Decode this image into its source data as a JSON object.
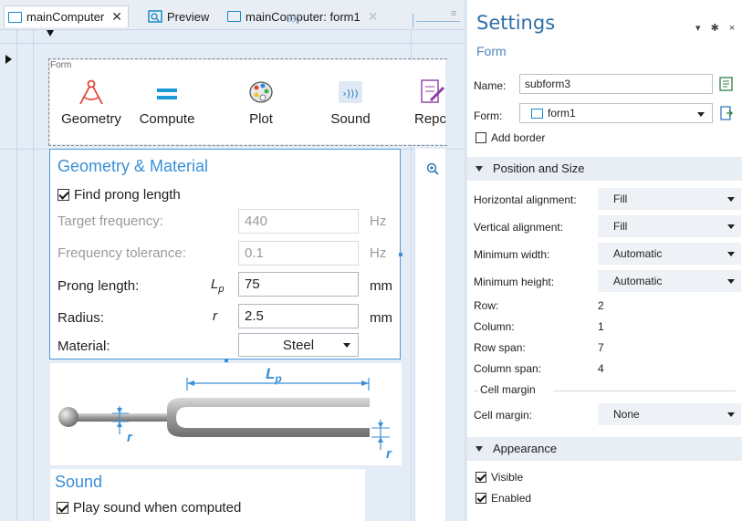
{
  "tabs": [
    {
      "label": "mainComputer",
      "close": "✕",
      "active": true
    },
    {
      "label": "Preview",
      "close": "",
      "active": false
    },
    {
      "label": "mainComputer: form1",
      "close": "✕",
      "active": false
    }
  ],
  "tab_overflow": "≡",
  "ruler": {
    "value": "130"
  },
  "form": {
    "label": "Form",
    "ribbon": [
      {
        "label": "Geometry",
        "icon": "geometry-icon"
      },
      {
        "label": "Compute",
        "icon": "compute-icon"
      },
      {
        "label": "Plot",
        "icon": "plot-palette-icon"
      },
      {
        "label": "Sound",
        "icon": "sound-icon"
      },
      {
        "label": "Repc",
        "icon": "report-icon"
      }
    ]
  },
  "geometry_material": {
    "title": "Geometry & Material",
    "find_prong": {
      "label": "Find prong length",
      "checked": true
    },
    "fields": [
      {
        "label": "Target frequency:",
        "symbol": "",
        "value": "440",
        "unit": "Hz",
        "enabled": false
      },
      {
        "label": "Frequency tolerance:",
        "symbol": "",
        "value": "0.1",
        "unit": "Hz",
        "enabled": false
      },
      {
        "label": "Prong length:",
        "symbol": "L",
        "symbol_sub": "p",
        "value": "75",
        "unit": "mm",
        "enabled": true
      },
      {
        "label": "Radius:",
        "symbol": "r",
        "symbol_sub": "",
        "value": "2.5",
        "unit": "mm",
        "enabled": true
      }
    ],
    "material": {
      "label": "Material:",
      "value": "Steel"
    }
  },
  "fork": {
    "length_label": "L",
    "length_sub": "p",
    "radius_label_left": "r",
    "radius_label_right": "r"
  },
  "sound": {
    "title": "Sound",
    "play": {
      "label": "Play sound when computed",
      "checked": true
    }
  },
  "settings": {
    "title": "Settings",
    "subtitle": "Form",
    "pins": "▾ ✱ ×",
    "name": {
      "label": "Name:",
      "value": "subform3"
    },
    "form": {
      "label": "Form:",
      "value": "form1"
    },
    "add_border": {
      "label": "Add border",
      "checked": false
    },
    "position_section": "Position and Size",
    "horizontal_alignment": {
      "label": "Horizontal alignment:",
      "value": "Fill"
    },
    "vertical_alignment": {
      "label": "Vertical alignment:",
      "value": "Fill"
    },
    "minimum_width": {
      "label": "Minimum width:",
      "value": "Automatic"
    },
    "minimum_height": {
      "label": "Minimum height:",
      "value": "Automatic"
    },
    "row": {
      "label": "Row:",
      "value": "2"
    },
    "column": {
      "label": "Column:",
      "value": "1"
    },
    "row_span": {
      "label": "Row span:",
      "value": "7"
    },
    "column_span": {
      "label": "Column span:",
      "value": "4"
    },
    "cell_margin_group": "Cell margin",
    "cell_margin": {
      "label": "Cell margin:",
      "value": "None"
    },
    "appearance_section": "Appearance",
    "visible": {
      "label": "Visible",
      "checked": true
    },
    "enabled": {
      "label": "Enabled",
      "checked": true
    }
  },
  "colors": {
    "accent": "#3a8fd6",
    "selection_border": "#4d98da",
    "settings_title": "#2f6fa8"
  }
}
